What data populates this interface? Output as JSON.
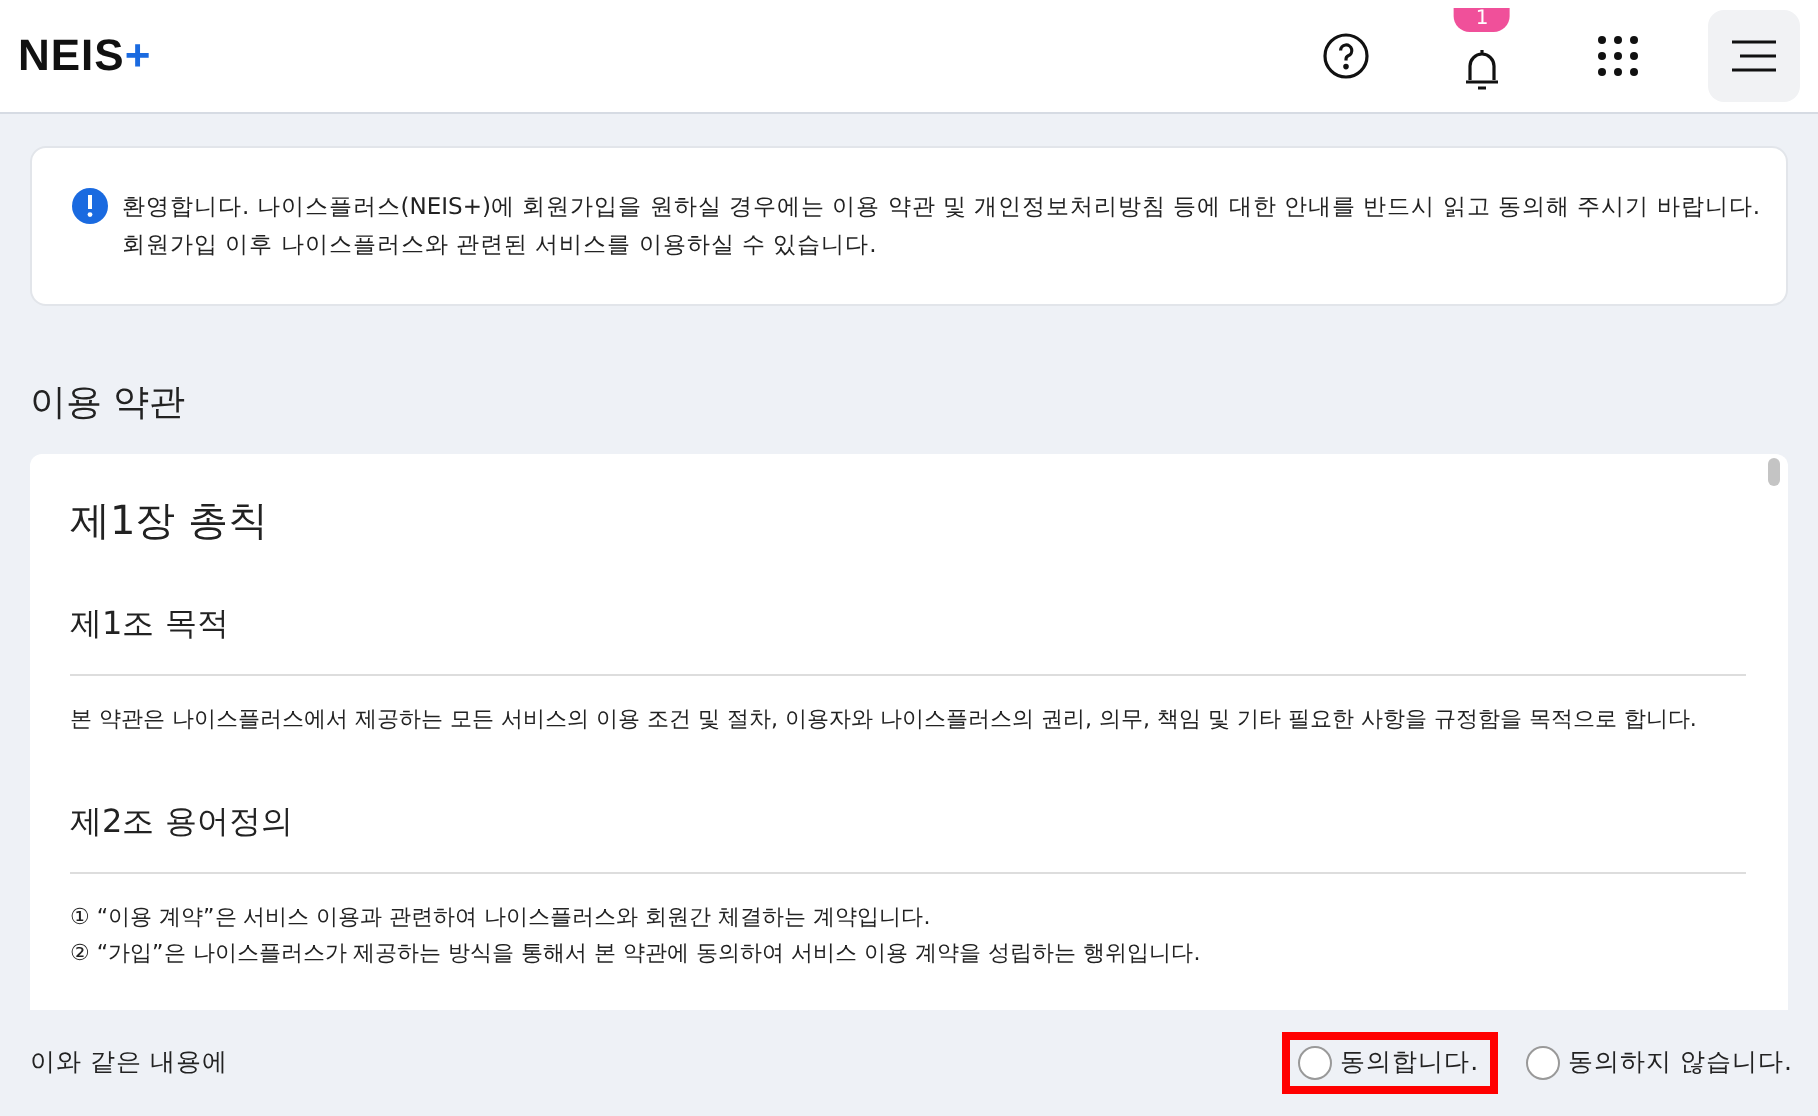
{
  "header": {
    "logo": {
      "text": "NEIS",
      "mark": "+"
    },
    "notification_badge": "1"
  },
  "notice": {
    "lines": [
      "환영합니다. 나이스플러스(NEIS+)에 회원가입을 원하실 경우에는 이용 약관 및 개인정보처리방침 등에 대한 안내를 반드시 읽고 동의해 주시기 바랍니다.",
      "회원가입 이후 나이스플러스와 관련된 서비스를 이용하실 수 있습니다."
    ]
  },
  "section_title": "이용 약관",
  "terms": {
    "chapter": "제1장 총칙",
    "articles": [
      {
        "title": "제1조 목적",
        "lines": [
          "본 약관은 나이스플러스에서 제공하는 모든 서비스의 이용 조건 및 절차, 이용자와 나이스플러스의 권리, 의무, 책임 및 기타 필요한 사항을 규정함을 목적으로 합니다."
        ]
      },
      {
        "title": "제2조 용어정의",
        "lines": [
          "① “이용 계약”은 서비스 이용과 관련하여 나이스플러스와 회원간 체결하는 계약입니다.",
          "② “가입”은 나이스플러스가 제공하는 방식을 통해서 본 약관에 동의하여 서비스 이용 계약을 성립하는 행위입니다."
        ]
      }
    ]
  },
  "agreement": {
    "prompt": "이와 같은 내용에",
    "options": [
      {
        "label": "동의합니다.",
        "selected": false,
        "highlighted": true
      },
      {
        "label": "동의하지 않습니다.",
        "selected": false,
        "highlighted": false
      }
    ]
  }
}
